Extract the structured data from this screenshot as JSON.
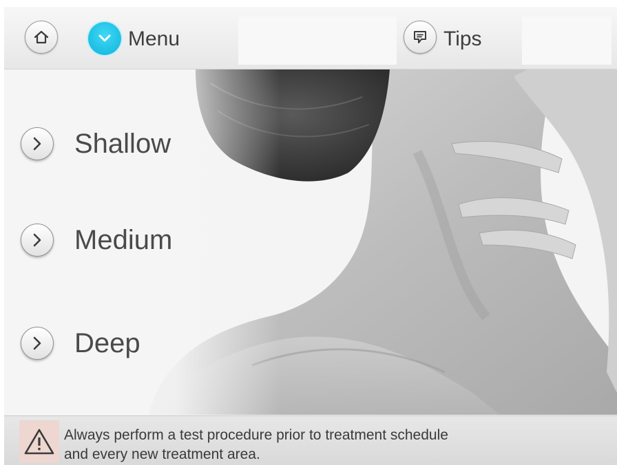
{
  "header": {
    "home_icon": "home-icon",
    "menu_label": "Menu",
    "menu_icon": "chevron-down-icon",
    "tips_label": "Tips",
    "tips_icon": "speech-bubble-icon",
    "accent_color": "#18bde2"
  },
  "options": [
    {
      "label": "Shallow",
      "icon": "chevron-right-icon"
    },
    {
      "label": "Medium",
      "icon": "chevron-right-icon"
    },
    {
      "label": "Deep",
      "icon": "chevron-right-icon"
    }
  ],
  "background_image": "grayscale photo of woman's neck and shoulder with hand touching jaw",
  "warning": {
    "icon": "warning-triangle-icon",
    "line1": "Always perform a test procedure prior to treatment schedule",
    "line2": "and every new treatment area."
  }
}
